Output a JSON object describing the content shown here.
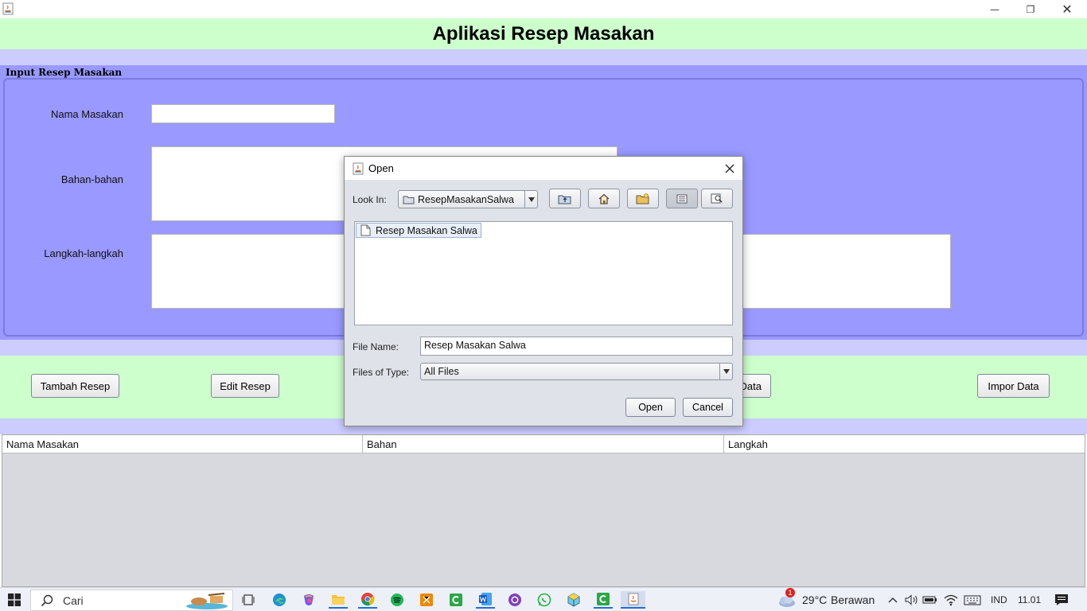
{
  "window": {
    "minimize": "—",
    "restore": "❐",
    "close": "✕"
  },
  "app": {
    "title": "Aplikasi Resep Masakan",
    "panel_title": "Input Resep Masakan",
    "fields": {
      "nama_label": "Nama Masakan",
      "bahan_label": "Bahan-bahan",
      "langkah_label": "Langkah-langkah",
      "nama_value": "",
      "bahan_value": "",
      "langkah_value": ""
    },
    "buttons": {
      "tambah": "Tambah Resep",
      "edit": "Edit Resep",
      "ekspor_visible": "Data",
      "impor": "Impor Data"
    },
    "table": {
      "columns": [
        "Nama Masakan",
        "Bahan",
        "Langkah"
      ],
      "rows": []
    }
  },
  "dialog": {
    "title": "Open",
    "look_in_label": "Look In:",
    "look_in_value": "ResepMasakanSalwa",
    "files": [
      "Resep Masakan Salwa"
    ],
    "file_name_label": "File Name:",
    "file_name_value": "Resep Masakan Salwa",
    "file_type_label": "Files of Type:",
    "file_type_value": "All Files",
    "open_button": "Open",
    "cancel_button": "Cancel",
    "toolbar_icons": [
      "up-folder-icon",
      "home-icon",
      "new-folder-icon",
      "list-view-icon",
      "details-view-icon"
    ]
  },
  "taskbar": {
    "search_placeholder": "Cari",
    "weather_temp": "29°C",
    "weather_text": "Berawan",
    "weather_badge": "1",
    "language": "IND",
    "time": "11.01"
  }
}
